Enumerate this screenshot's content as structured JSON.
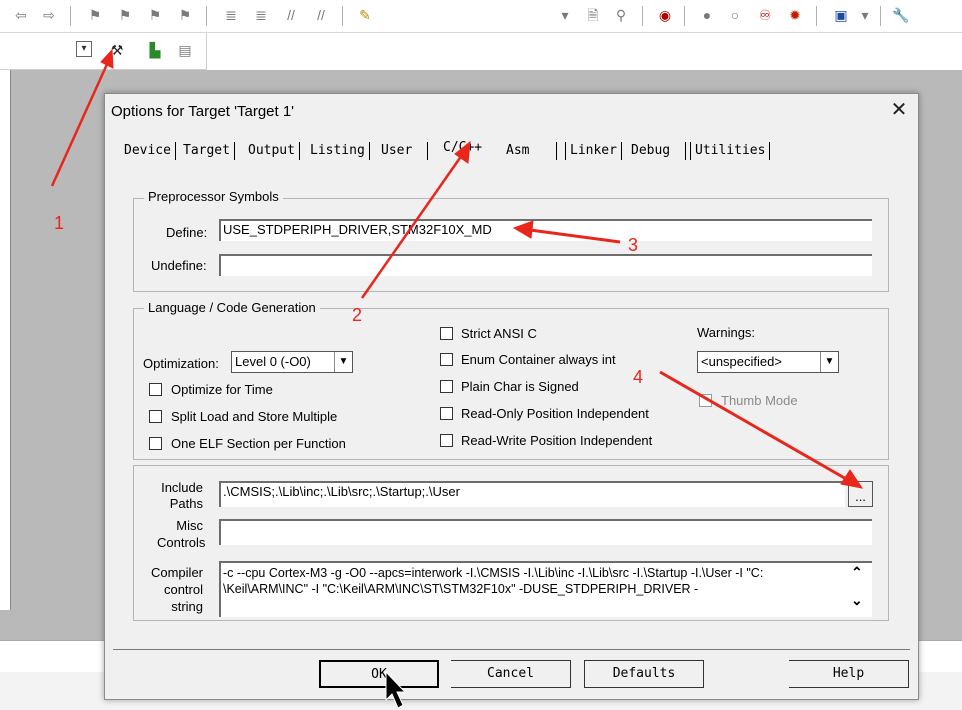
{
  "dialog": {
    "title": "Options for Target 'Target 1'",
    "close_glyph": "✕",
    "tabs": [
      "Device",
      "Target",
      "Output",
      "Listing",
      "User",
      "C/C++",
      "Asm",
      "Linker",
      "Debug",
      "Utilities"
    ],
    "active_tab": "C/C++"
  },
  "preprocessor": {
    "title": "Preprocessor Symbols",
    "define_label": "Define:",
    "define_value": "USE_STDPERIPH_DRIVER,STM32F10X_MD",
    "undefine_label": "Undefine:",
    "undefine_value": ""
  },
  "language": {
    "title": "Language / Code Generation",
    "optimization_label": "Optimization:",
    "optimization_value": "Level 0 (-O0)",
    "optimize_time": "Optimize for Time",
    "split_load": "Split Load and Store Multiple",
    "one_elf": "One ELF Section per Function",
    "strict_ansi": "Strict ANSI C",
    "enum_container": "Enum Container always int",
    "plain_char": "Plain Char is Signed",
    "ro_pos": "Read-Only Position Independent",
    "rw_pos": "Read-Write Position Independent",
    "warnings_label": "Warnings:",
    "warnings_value": "<unspecified>",
    "thumb_mode": "Thumb Mode"
  },
  "include": {
    "label_line1": "Include",
    "label_line2": "Paths",
    "value": ".\\CMSIS;.\\Lib\\inc;.\\Lib\\src;.\\Startup;.\\User",
    "browse": "..."
  },
  "misc": {
    "label_line1": "Misc",
    "label_line2": "Controls",
    "value": ""
  },
  "compiler": {
    "label_line1": "Compiler",
    "label_line2": "control",
    "label_line3": "string",
    "line1": "-c --cpu Cortex-M3 -g -O0 --apcs=interwork -I.\\CMSIS -I.\\Lib\\inc -I.\\Lib\\src -I.\\Startup -I.\\User -I \"C:",
    "line2": "\\Keil\\ARM\\INC\" -I \"C:\\Keil\\ARM\\INC\\ST\\STM32F10x\" -DUSE_STDPERIPH_DRIVER -",
    "scroll_up": "⌃",
    "scroll_down": "⌄"
  },
  "buttons": {
    "ok": "OK",
    "cancel": "Cancel",
    "defaults": "Defaults",
    "help": "Help"
  },
  "annotations": [
    "1",
    "2",
    "3",
    "4"
  ],
  "colors": {
    "annotation": "#e8261c",
    "dialog_bg": "#f0f0f0"
  }
}
